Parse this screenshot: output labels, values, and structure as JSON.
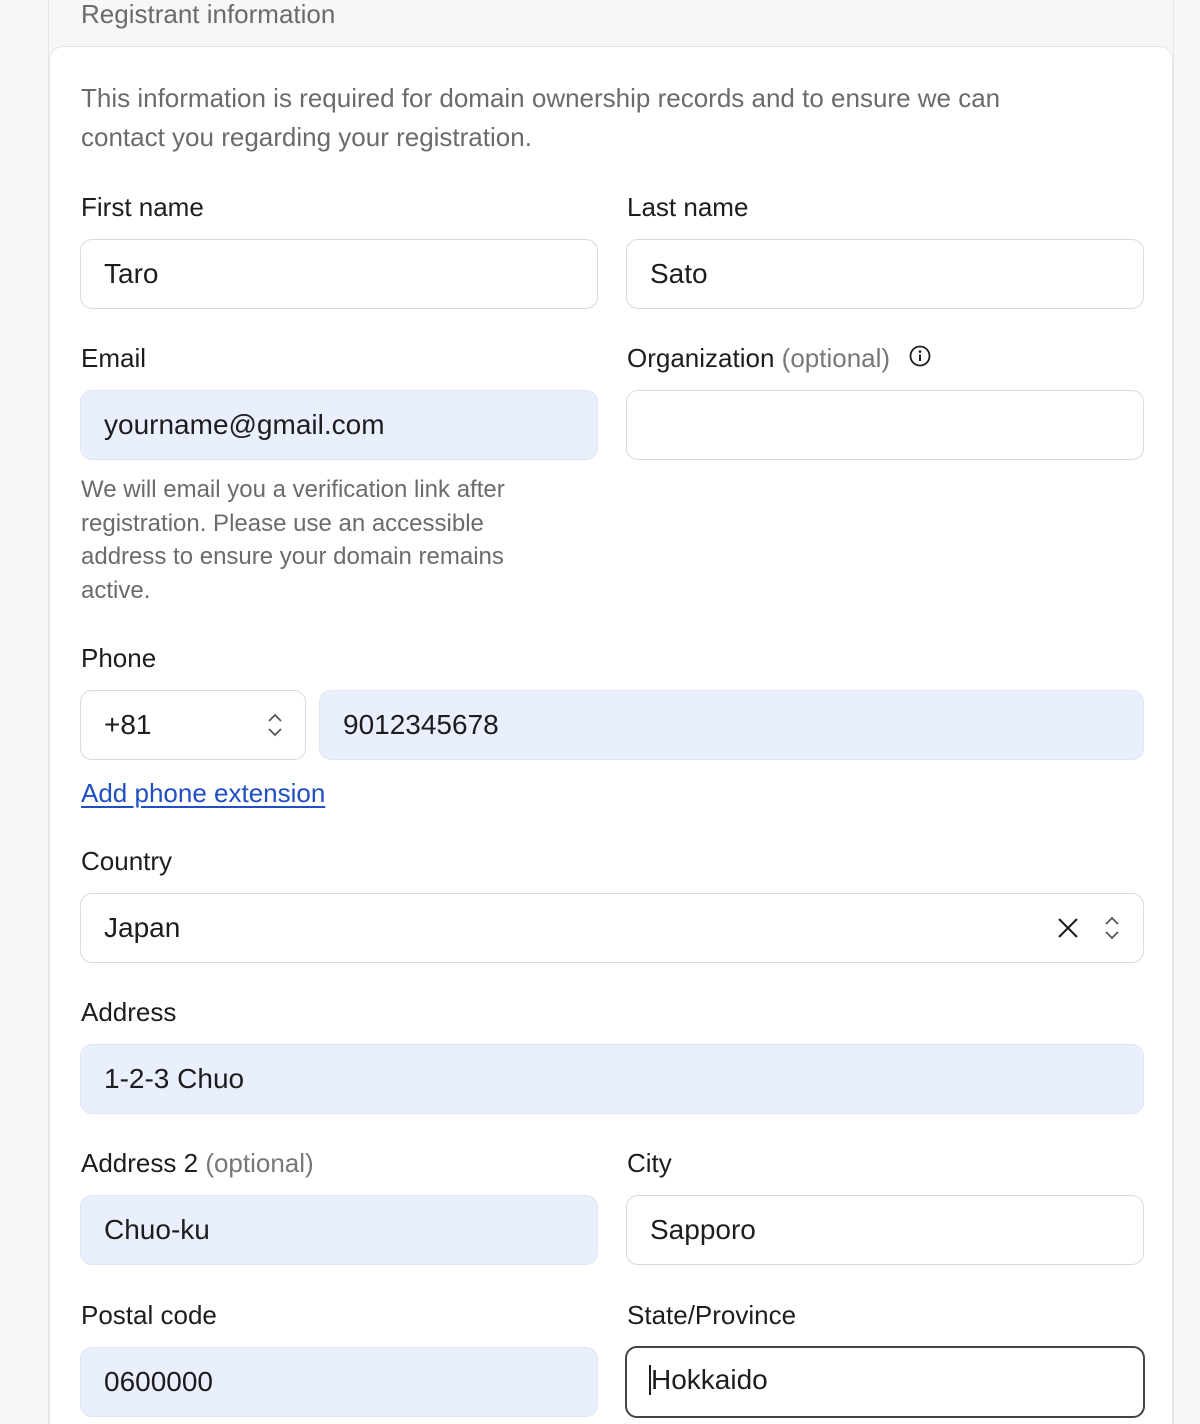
{
  "section": {
    "title": "Registrant information",
    "intro": "This information is required for domain ownership records and to ensure we can contact you regarding your registration."
  },
  "fields": {
    "first_name": {
      "label": "First name",
      "value": "Taro"
    },
    "last_name": {
      "label": "Last name",
      "value": "Sato"
    },
    "email": {
      "label": "Email",
      "value": "yourname@gmail.com",
      "help": "We will email you a verification link after registration. Please use an accessible address to ensure your domain remains active."
    },
    "organization": {
      "label": "Organization",
      "optional": "(optional)",
      "value": ""
    },
    "phone": {
      "label": "Phone",
      "country_code": "+81",
      "number": "9012345678",
      "add_extension": "Add phone extension"
    },
    "country": {
      "label": "Country",
      "value": "Japan"
    },
    "address": {
      "label": "Address",
      "value": "1-2-3 Chuo"
    },
    "address2": {
      "label": "Address 2",
      "optional": "(optional)",
      "value": "Chuo-ku"
    },
    "city": {
      "label": "City",
      "value": "Sapporo"
    },
    "postal_code": {
      "label": "Postal code",
      "value": "0600000"
    },
    "state": {
      "label": "State/Province",
      "value": "Hokkaido"
    }
  },
  "icons": {
    "info": "info-circle-icon",
    "stepper": "chevron-up-down-icon",
    "clear": "close-icon"
  },
  "colors": {
    "link": "#1f4fc1",
    "autofill_bg": "#e9effc",
    "focus_border": "#444444"
  }
}
